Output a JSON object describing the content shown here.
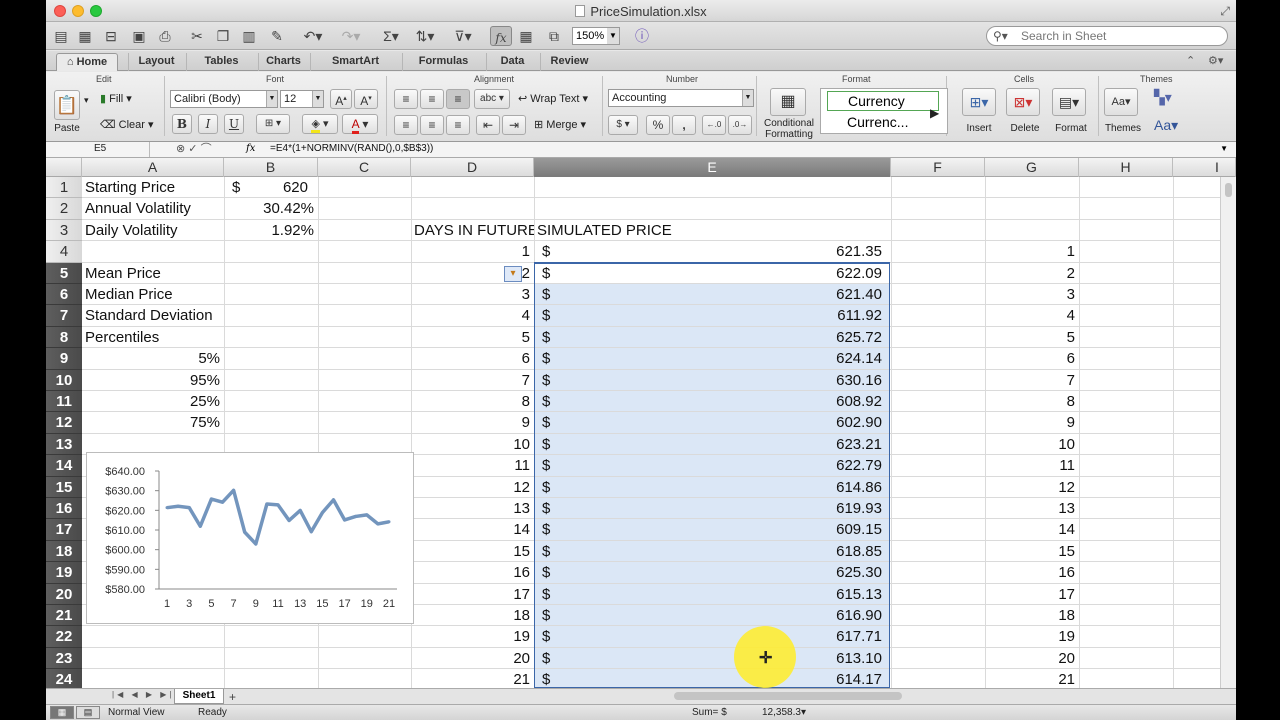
{
  "window": {
    "title": "PriceSimulation.xlsx"
  },
  "toolbar": {
    "zoom": "150%",
    "search_placeholder": "Search in Sheet"
  },
  "ribbon_tabs": [
    "Home",
    "Layout",
    "Tables",
    "Charts",
    "SmartArt",
    "Formulas",
    "Data",
    "Review"
  ],
  "ribbon": {
    "groups": {
      "edit": "Edit",
      "font": "Font",
      "alignment": "Alignment",
      "number": "Number",
      "format": "Format",
      "cells": "Cells",
      "themes": "Themes"
    },
    "paste": "Paste",
    "fill": "Fill",
    "clear": "Clear",
    "font_name": "Calibri (Body)",
    "font_size": "12",
    "wrap_text": "Wrap Text",
    "merge": "Merge",
    "number_format": "Accounting",
    "conditional_formatting_1": "Conditional",
    "conditional_formatting_2": "Formatting",
    "style_1": "Currency",
    "style_2": "Currenc...",
    "insert": "Insert",
    "delete": "Delete",
    "format": "Format",
    "themes": "Themes",
    "bold": "B",
    "italic": "I",
    "underline": "U",
    "increase_font": "A",
    "decrease_font": "A",
    "font_color": "A",
    "abc": "abc",
    "percent": "%",
    "comma": ",",
    "aa": "Aa",
    "aa_small": "Aa"
  },
  "formula_bar": {
    "cell_ref": "E5",
    "fx": "fx",
    "formula": "=E4*(1+NORMINV(RAND(),0,$B$3))"
  },
  "columns": [
    "A",
    "B",
    "C",
    "D",
    "E",
    "F",
    "G",
    "H"
  ],
  "rows": [
    "1",
    "2",
    "3",
    "4",
    "5",
    "6",
    "7",
    "8",
    "9",
    "10",
    "11",
    "12",
    "13",
    "14",
    "15",
    "16",
    "17",
    "18",
    "19",
    "20",
    "21",
    "22",
    "23",
    "24"
  ],
  "cells": {
    "a1": "Starting Price",
    "b1_sym": "$",
    "b1_val": "620",
    "a2": "Annual Volatility",
    "b2": "30.42%",
    "a3": "Daily Volatility",
    "b3": "1.92%",
    "a5": "Mean Price",
    "a6": "Median Price",
    "a7": "Standard Deviation",
    "a8": "Percentiles",
    "a9": "5%",
    "a10": "95%",
    "a11": "25%",
    "a12": "75%",
    "d3": "DAYS IN FUTURE",
    "e3": "SIMULATED PRICE"
  },
  "sim_rows": [
    {
      "day": "1",
      "sym": "$",
      "price": "621.35",
      "g": "1"
    },
    {
      "day": "2",
      "sym": "$",
      "price": "622.09",
      "g": "2"
    },
    {
      "day": "3",
      "sym": "$",
      "price": "621.40",
      "g": "3"
    },
    {
      "day": "4",
      "sym": "$",
      "price": "611.92",
      "g": "4"
    },
    {
      "day": "5",
      "sym": "$",
      "price": "625.72",
      "g": "5"
    },
    {
      "day": "6",
      "sym": "$",
      "price": "624.14",
      "g": "6"
    },
    {
      "day": "7",
      "sym": "$",
      "price": "630.16",
      "g": "7"
    },
    {
      "day": "8",
      "sym": "$",
      "price": "608.92",
      "g": "8"
    },
    {
      "day": "9",
      "sym": "$",
      "price": "602.90",
      "g": "9"
    },
    {
      "day": "10",
      "sym": "$",
      "price": "623.21",
      "g": "10"
    },
    {
      "day": "11",
      "sym": "$",
      "price": "622.79",
      "g": "11"
    },
    {
      "day": "12",
      "sym": "$",
      "price": "614.86",
      "g": "12"
    },
    {
      "day": "13",
      "sym": "$",
      "price": "619.93",
      "g": "13"
    },
    {
      "day": "14",
      "sym": "$",
      "price": "609.15",
      "g": "14"
    },
    {
      "day": "15",
      "sym": "$",
      "price": "618.85",
      "g": "15"
    },
    {
      "day": "16",
      "sym": "$",
      "price": "625.30",
      "g": "16"
    },
    {
      "day": "17",
      "sym": "$",
      "price": "615.13",
      "g": "17"
    },
    {
      "day": "18",
      "sym": "$",
      "price": "616.90",
      "g": "18"
    },
    {
      "day": "19",
      "sym": "$",
      "price": "617.71",
      "g": "19"
    },
    {
      "day": "20",
      "sym": "$",
      "price": "613.10",
      "g": "20"
    },
    {
      "day": "21",
      "sym": "$",
      "price": "614.17",
      "g": "21"
    }
  ],
  "sheet_tabs": [
    "Sheet1"
  ],
  "status": {
    "view": "Normal View",
    "state": "Ready",
    "sum_label": "Sum=",
    "sum_sym": "$",
    "sum_value": "12,358.3"
  },
  "chart_data": {
    "type": "line",
    "title": "",
    "xlabel": "",
    "ylabel": "",
    "x_ticks": [
      "1",
      "3",
      "5",
      "7",
      "9",
      "11",
      "13",
      "15",
      "17",
      "19",
      "21"
    ],
    "y_ticks": [
      "$640.00",
      "$630.00",
      "$620.00",
      "$610.00",
      "$600.00",
      "$590.00",
      "$580.00"
    ],
    "ylim": [
      580,
      640
    ],
    "x": [
      1,
      2,
      3,
      4,
      5,
      6,
      7,
      8,
      9,
      10,
      11,
      12,
      13,
      14,
      15,
      16,
      17,
      18,
      19,
      20,
      21
    ],
    "values": [
      621.35,
      622.09,
      621.4,
      611.92,
      625.72,
      624.14,
      630.16,
      608.92,
      602.9,
      623.21,
      622.79,
      614.86,
      619.93,
      609.15,
      618.85,
      625.3,
      615.13,
      616.9,
      617.71,
      613.1,
      614.17
    ],
    "line_color": "#7395bd",
    "grid": false,
    "legend": "none"
  }
}
